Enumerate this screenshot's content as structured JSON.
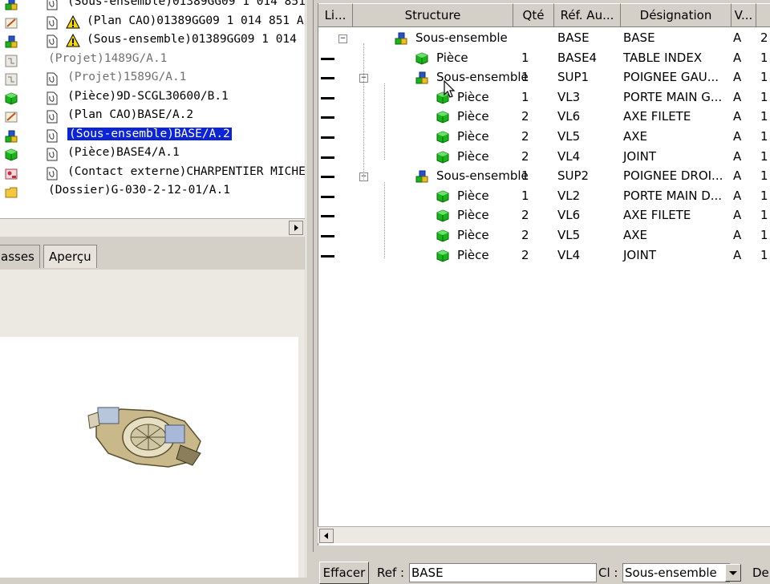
{
  "left_panel": {
    "items": [
      {
        "icon": "assembly-icon",
        "doc": true,
        "warn": false,
        "text": "(Sous-ensemble)01389GG09 1 014 851",
        "style": "normal"
      },
      {
        "icon": "cad-plan-icon",
        "doc": true,
        "warn": true,
        "text": "(Plan CAO)01389GG09 1 014 851 A",
        "style": "normal"
      },
      {
        "icon": "assembly-icon",
        "doc": true,
        "warn": true,
        "text": "(Sous-ensemble)01389GG09 1 014",
        "style": "normal"
      },
      {
        "icon": "project-icon",
        "doc": false,
        "warn": false,
        "text": "(Projet)1489G/A.1",
        "style": "gray"
      },
      {
        "icon": "project-icon",
        "doc": true,
        "warn": false,
        "text": "(Projet)1589G/A.1",
        "style": "gray"
      },
      {
        "icon": "part-icon",
        "doc": true,
        "warn": false,
        "text": "(Pièce)9D-SCGL30600/B.1",
        "style": "normal"
      },
      {
        "icon": "cad-plan-icon",
        "doc": true,
        "warn": false,
        "text": "(Plan CAO)BASE/A.2",
        "style": "normal"
      },
      {
        "icon": "assembly-icon",
        "doc": true,
        "warn": false,
        "text": "(Sous-ensemble)BASE/A.2",
        "style": "selected"
      },
      {
        "icon": "part-icon",
        "doc": true,
        "warn": false,
        "text": "(Pièce)BASE4/A.1",
        "style": "normal"
      },
      {
        "icon": "contact-icon",
        "doc": true,
        "warn": false,
        "text": "(Contact externe)CHARPENTIER MICHE",
        "style": "normal"
      },
      {
        "icon": "folder-icon",
        "doc": false,
        "warn": false,
        "text": "(Dossier)G-030-2-12-01/A.1",
        "style": "normal"
      }
    ]
  },
  "tabs": [
    {
      "label": "asses",
      "active": false
    },
    {
      "label": "Aperçu",
      "active": true
    }
  ],
  "grid": {
    "columns": [
      "Li...",
      "Structure",
      "Qté",
      "Réf. Au...",
      "Désignation",
      "V...",
      ""
    ],
    "rows": [
      {
        "level": 0,
        "type": "assembly",
        "dash": false,
        "structure": "Sous-ensemble",
        "qty": "",
        "ref": "BASE",
        "designation": "BASE",
        "v": "A",
        "extra": "2"
      },
      {
        "level": 1,
        "type": "part",
        "dash": true,
        "structure": "Pièce",
        "qty": "1",
        "ref": "BASE4",
        "designation": "TABLE INDEX",
        "v": "A",
        "extra": "1"
      },
      {
        "level": 1,
        "type": "assembly",
        "dash": true,
        "structure": "Sous-ensemble",
        "qty": "1",
        "ref": "SUP1",
        "designation": "POIGNEE GAU...",
        "v": "A",
        "extra": "1"
      },
      {
        "level": 2,
        "type": "part",
        "dash": true,
        "structure": "Pièce",
        "qty": "1",
        "ref": "VL3",
        "designation": "PORTE MAIN G...",
        "v": "A",
        "extra": "1"
      },
      {
        "level": 2,
        "type": "part",
        "dash": true,
        "structure": "Pièce",
        "qty": "2",
        "ref": "VL6",
        "designation": "AXE FILETE",
        "v": "A",
        "extra": "1"
      },
      {
        "level": 2,
        "type": "part",
        "dash": true,
        "structure": "Pièce",
        "qty": "2",
        "ref": "VL5",
        "designation": "AXE",
        "v": "A",
        "extra": "1"
      },
      {
        "level": 2,
        "type": "part",
        "dash": true,
        "structure": "Pièce",
        "qty": "2",
        "ref": "VL4",
        "designation": "JOINT",
        "v": "A",
        "extra": "1"
      },
      {
        "level": 1,
        "type": "assembly",
        "dash": true,
        "structure": "Sous-ensemble",
        "qty": "1",
        "ref": "SUP2",
        "designation": "POIGNEE DROI...",
        "v": "A",
        "extra": "1"
      },
      {
        "level": 2,
        "type": "part",
        "dash": true,
        "structure": "Pièce",
        "qty": "1",
        "ref": "VL2",
        "designation": "PORTE MAIN D...",
        "v": "A",
        "extra": "1"
      },
      {
        "level": 2,
        "type": "part",
        "dash": true,
        "structure": "Pièce",
        "qty": "2",
        "ref": "VL6",
        "designation": "AXE FILETE",
        "v": "A",
        "extra": "1"
      },
      {
        "level": 2,
        "type": "part",
        "dash": true,
        "structure": "Pièce",
        "qty": "2",
        "ref": "VL5",
        "designation": "AXE",
        "v": "A",
        "extra": "1"
      },
      {
        "level": 2,
        "type": "part",
        "dash": true,
        "structure": "Pièce",
        "qty": "2",
        "ref": "VL4",
        "designation": "JOINT",
        "v": "A",
        "extra": "1"
      }
    ]
  },
  "form": {
    "clear_label": "Effacer",
    "ref_label": "Ref :",
    "ref_value": "BASE",
    "class_label": "Cl :",
    "class_value": "Sous-ensemble",
    "des_label": "De"
  },
  "colors": {
    "selection": "#0a24d6",
    "part_green": "#19b419",
    "assembly_blue": "#2255cc",
    "warning_yellow": "#f5d800"
  }
}
